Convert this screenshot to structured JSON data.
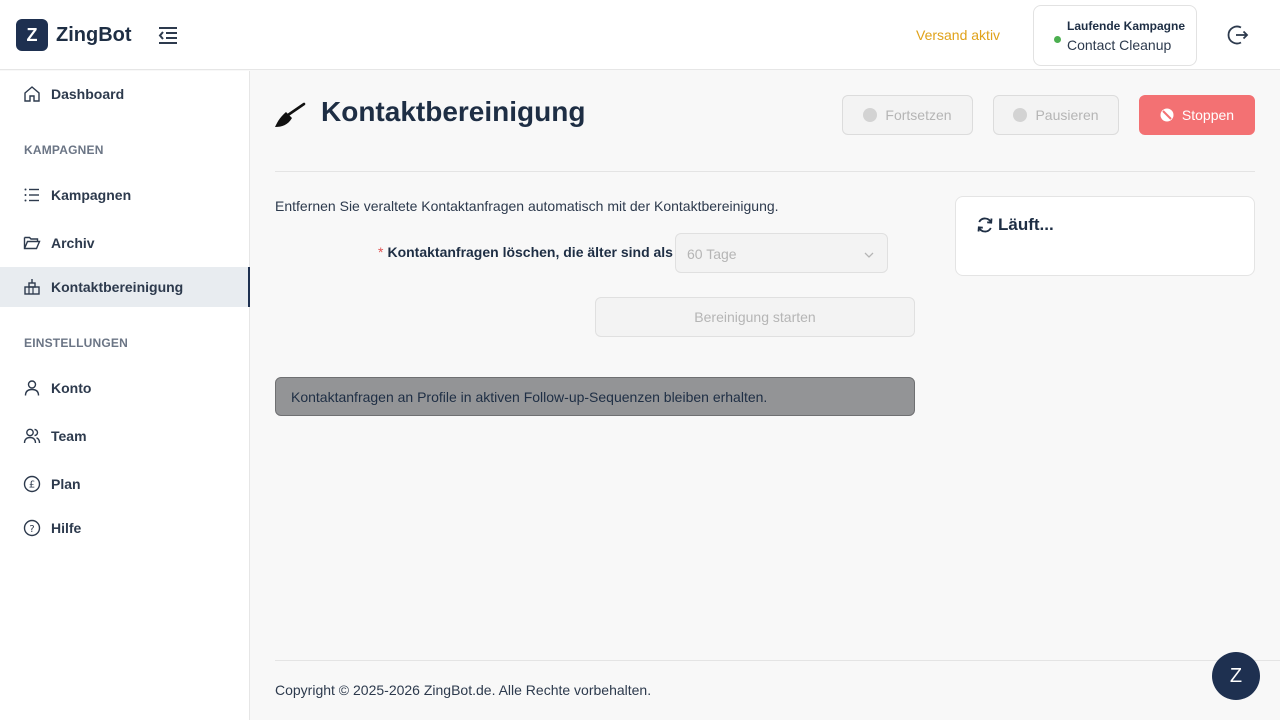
{
  "header": {
    "logo_letter": "Z",
    "brand": "ZingBot",
    "status": "Versand aktiv",
    "campaign_title": "Laufende Kampagne",
    "campaign_name": "Contact Cleanup",
    "status_color": "#e0a21a",
    "dot_color": "#4caf50"
  },
  "sidebar": {
    "dashboard": "Dashboard",
    "section_campaigns": "KAMPAGNEN",
    "campaigns": "Kampagnen",
    "archive": "Archiv",
    "cleanup": "Kontaktbereinigung",
    "section_settings": "EINSTELLUNGEN",
    "account": "Konto",
    "team": "Team",
    "plan": "Plan",
    "help": "Hilfe"
  },
  "main": {
    "title": "Kontaktbereinigung",
    "btn_resume": "Fortsetzen",
    "btn_pause": "Pausieren",
    "btn_stop": "Stoppen",
    "description": "Entfernen Sie veraltete Kontaktanfragen automatisch mit der Kontaktbereinigung.",
    "field_required": "*",
    "field_label": "Kontaktanfragen löschen, die älter sind als",
    "field_colon": ":",
    "select_value": "60 Tage",
    "start_button": "Bereinigung starten",
    "info": "Kontaktanfragen an Profile in aktiven Follow-up-Sequenzen bleiben erhalten.",
    "status": "Läuft...",
    "accent_stop": "#f37173"
  },
  "footer": {
    "copyright": "Copyright © 2025-2026 ZingBot.de. Alle Rechte vorbehalten.",
    "chat_letter": "Z"
  }
}
